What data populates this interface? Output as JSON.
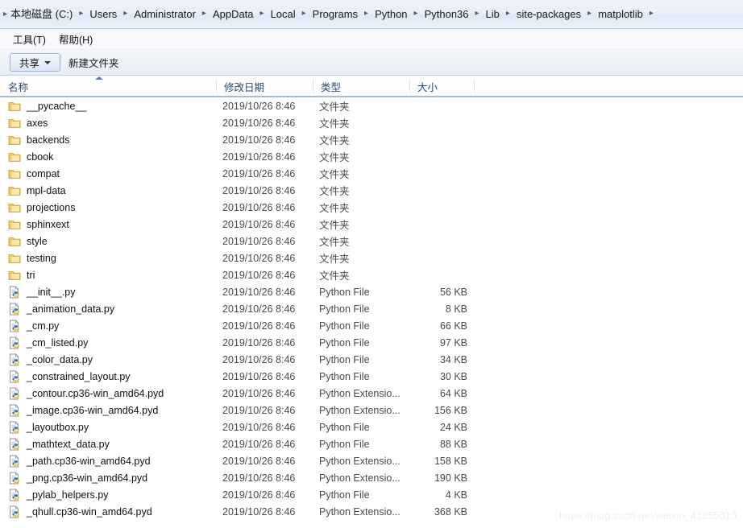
{
  "address_bar": {
    "lead_separator": "▸",
    "separator": "▸",
    "crumbs": [
      "本地磁盘 (C:)",
      "Users",
      "Administrator",
      "AppData",
      "Local",
      "Programs",
      "Python",
      "Python36",
      "Lib",
      "site-packages",
      "matplotlib"
    ]
  },
  "menu_bar": {
    "items": [
      {
        "label": "工具(T)",
        "name": "menu-tools"
      },
      {
        "label": "帮助(H)",
        "name": "menu-help"
      }
    ]
  },
  "toolbar": {
    "share_label": "共享",
    "new_folder_label": "新建文件夹"
  },
  "columns": {
    "name": "名称",
    "date_modified": "修改日期",
    "type": "类型",
    "size": "大小",
    "sorted_by": "名称",
    "sort_direction": "ascending"
  },
  "files": [
    {
      "name": "__pycache__",
      "date": "2019/10/26 8:46",
      "type": "文件夹",
      "size": "",
      "icon": "folder-icon"
    },
    {
      "name": "axes",
      "date": "2019/10/26 8:46",
      "type": "文件夹",
      "size": "",
      "icon": "folder-icon"
    },
    {
      "name": "backends",
      "date": "2019/10/26 8:46",
      "type": "文件夹",
      "size": "",
      "icon": "folder-icon"
    },
    {
      "name": "cbook",
      "date": "2019/10/26 8:46",
      "type": "文件夹",
      "size": "",
      "icon": "folder-icon"
    },
    {
      "name": "compat",
      "date": "2019/10/26 8:46",
      "type": "文件夹",
      "size": "",
      "icon": "folder-icon"
    },
    {
      "name": "mpl-data",
      "date": "2019/10/26 8:46",
      "type": "文件夹",
      "size": "",
      "icon": "folder-icon"
    },
    {
      "name": "projections",
      "date": "2019/10/26 8:46",
      "type": "文件夹",
      "size": "",
      "icon": "folder-icon"
    },
    {
      "name": "sphinxext",
      "date": "2019/10/26 8:46",
      "type": "文件夹",
      "size": "",
      "icon": "folder-icon"
    },
    {
      "name": "style",
      "date": "2019/10/26 8:46",
      "type": "文件夹",
      "size": "",
      "icon": "folder-icon"
    },
    {
      "name": "testing",
      "date": "2019/10/26 8:46",
      "type": "文件夹",
      "size": "",
      "icon": "folder-icon"
    },
    {
      "name": "tri",
      "date": "2019/10/26 8:46",
      "type": "文件夹",
      "size": "",
      "icon": "folder-icon"
    },
    {
      "name": "__init__.py",
      "date": "2019/10/26 8:46",
      "type": "Python File",
      "size": "56 KB",
      "icon": "python-file-icon"
    },
    {
      "name": "_animation_data.py",
      "date": "2019/10/26 8:46",
      "type": "Python File",
      "size": "8 KB",
      "icon": "python-file-icon"
    },
    {
      "name": "_cm.py",
      "date": "2019/10/26 8:46",
      "type": "Python File",
      "size": "66 KB",
      "icon": "python-file-icon"
    },
    {
      "name": "_cm_listed.py",
      "date": "2019/10/26 8:46",
      "type": "Python File",
      "size": "97 KB",
      "icon": "python-file-icon"
    },
    {
      "name": "_color_data.py",
      "date": "2019/10/26 8:46",
      "type": "Python File",
      "size": "34 KB",
      "icon": "python-file-icon"
    },
    {
      "name": "_constrained_layout.py",
      "date": "2019/10/26 8:46",
      "type": "Python File",
      "size": "30 KB",
      "icon": "python-file-icon"
    },
    {
      "name": "_contour.cp36-win_amd64.pyd",
      "date": "2019/10/26 8:46",
      "type": "Python Extensio...",
      "size": "64 KB",
      "icon": "python-ext-icon"
    },
    {
      "name": "_image.cp36-win_amd64.pyd",
      "date": "2019/10/26 8:46",
      "type": "Python Extensio...",
      "size": "156 KB",
      "icon": "python-ext-icon"
    },
    {
      "name": "_layoutbox.py",
      "date": "2019/10/26 8:46",
      "type": "Python File",
      "size": "24 KB",
      "icon": "python-file-icon"
    },
    {
      "name": "_mathtext_data.py",
      "date": "2019/10/26 8:46",
      "type": "Python File",
      "size": "88 KB",
      "icon": "python-file-icon"
    },
    {
      "name": "_path.cp36-win_amd64.pyd",
      "date": "2019/10/26 8:46",
      "type": "Python Extensio...",
      "size": "158 KB",
      "icon": "python-ext-icon"
    },
    {
      "name": "_png.cp36-win_amd64.pyd",
      "date": "2019/10/26 8:46",
      "type": "Python Extensio...",
      "size": "190 KB",
      "icon": "python-ext-icon"
    },
    {
      "name": "_pylab_helpers.py",
      "date": "2019/10/26 8:46",
      "type": "Python File",
      "size": "4 KB",
      "icon": "python-file-icon"
    },
    {
      "name": "_qhull.cp36-win_amd64.pyd",
      "date": "2019/10/26 8:46",
      "type": "Python Extensio...",
      "size": "368 KB",
      "icon": "python-ext-icon"
    }
  ],
  "watermark": {
    "text": "https://blog.csdn.net/weixin_41855010"
  },
  "colors": {
    "header_text": "#2b4a73",
    "row_text": "#1a1a1a",
    "secondary_text": "#4a4a4a",
    "folder_yellow": "#f5c451",
    "accent_border": "#a7bcd4",
    "watermark": "#efefef"
  }
}
